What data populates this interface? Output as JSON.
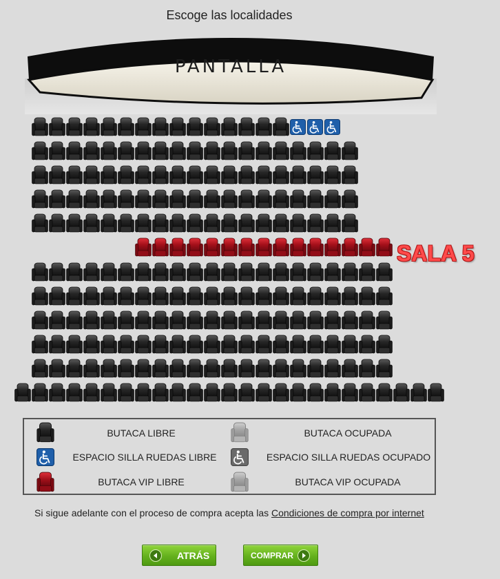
{
  "page": {
    "title": "Escoge las localidades",
    "screen_label": "PANTALLA",
    "room_label": "SALA 5"
  },
  "seat_map": {
    "rows": [
      {
        "row": 1,
        "free": 15,
        "wheelchair_free": 3
      },
      {
        "row": 2,
        "free": 19
      },
      {
        "row": 3,
        "free": 19
      },
      {
        "row": 4,
        "free": 19
      },
      {
        "row": 5,
        "free": 19
      },
      {
        "row": 6,
        "vip_free": 15
      },
      {
        "row": 7,
        "free": 21
      },
      {
        "row": 8,
        "free": 21
      },
      {
        "row": 9,
        "free": 21
      },
      {
        "row": 10,
        "free": 21
      },
      {
        "row": 11,
        "free": 21
      },
      {
        "row": 12,
        "free": 25
      }
    ]
  },
  "legend": {
    "free_seat": "BUTACA LIBRE",
    "occupied_seat": "BUTACA OCUPADA",
    "wheelchair_free": "ESPACIO SILLA RUEDAS LIBRE",
    "wheelchair_occupied": "ESPACIO SILLA RUEDAS OCUPADO",
    "vip_free": "BUTACA VIP LIBRE",
    "vip_occupied": "BUTACA VIP OCUPADA"
  },
  "terms": {
    "text": "Si sigue adelante con el proceso de compra acepta las",
    "link": "Condiciones de compra por internet"
  },
  "buttons": {
    "back": "ATRÁS",
    "buy": "COMPRAR"
  },
  "colors": {
    "background": "#dcdcdc",
    "seat_free": "#2b2b2b",
    "seat_occupied": "#9a9a9a",
    "vip_free": "#a3101a",
    "wheelchair": "#1f5faa",
    "button_green": "#64b11d",
    "room_label": "#ff4b4b"
  }
}
